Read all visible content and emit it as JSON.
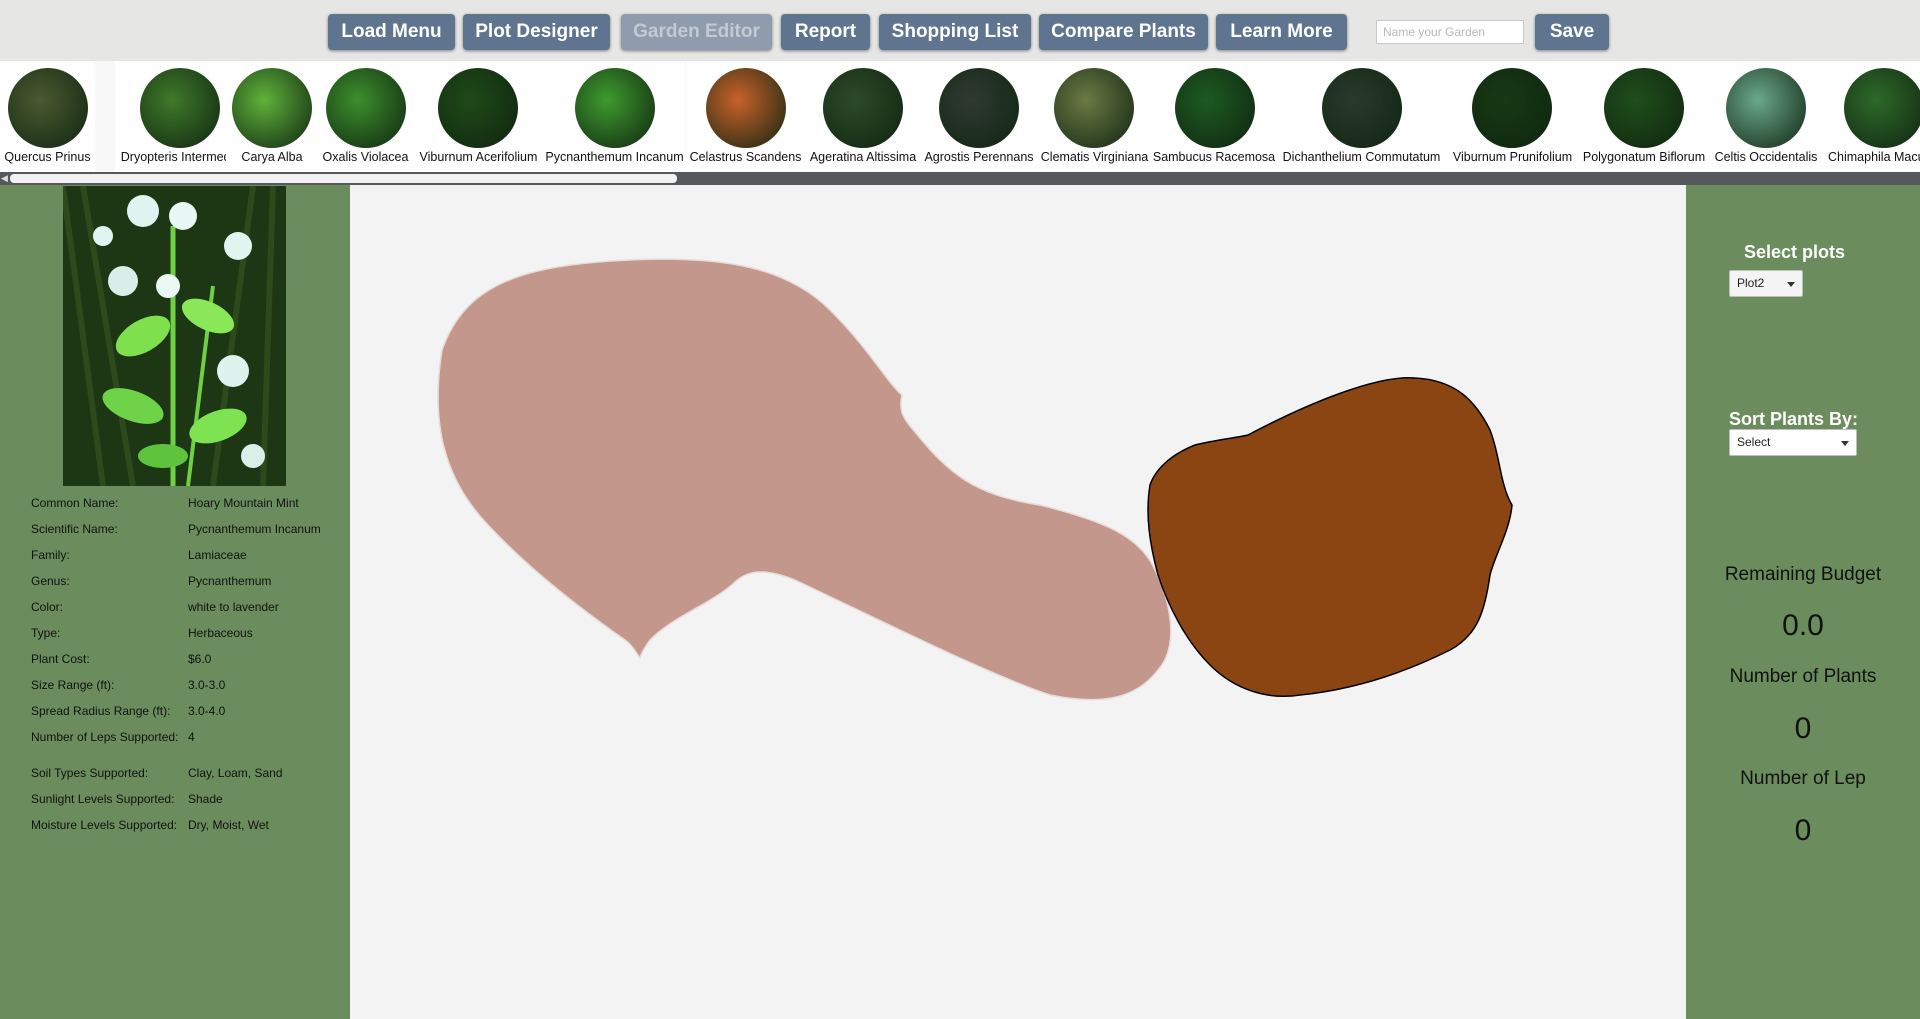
{
  "toolbar": {
    "buttons": [
      {
        "label": "Load Menu",
        "disabled": false
      },
      {
        "label": "Plot Designer",
        "disabled": false
      },
      {
        "label": "Garden Editor",
        "disabled": true
      },
      {
        "label": "Report",
        "disabled": false
      },
      {
        "label": "Shopping List",
        "disabled": false
      },
      {
        "label": "Compare Plants",
        "disabled": false
      },
      {
        "label": "Learn More",
        "disabled": false
      }
    ],
    "garden_name_placeholder": "Name your Garden",
    "garden_name_value": "",
    "save_label": "Save"
  },
  "plants": [
    {
      "name": "Quercus Prinus",
      "icon": "bark-photo",
      "color": "#4a5a30"
    },
    {
      "name": "Dryopteris Intermedia",
      "icon": "fern-photo",
      "color": "#3f7a2a"
    },
    {
      "name": "Carya Alba",
      "icon": "leaf-photo",
      "color": "#5fb23a"
    },
    {
      "name": "Oxalis Violacea",
      "icon": "violet-flower-photo",
      "color": "#3c8f2c"
    },
    {
      "name": "Viburnum Acerifolium",
      "icon": "white-flower-photo",
      "color": "#1e4a17"
    },
    {
      "name": "Pycnanthemum Incanum",
      "icon": "mint-photo",
      "color": "#3e9a2e"
    },
    {
      "name": "Celastrus Scandens",
      "icon": "berry-photo",
      "color": "#c9622a"
    },
    {
      "name": "Ageratina Altissima",
      "icon": "white-cluster-photo",
      "color": "#2c4a28"
    },
    {
      "name": "Agrostis Perennans",
      "icon": "grass-photo",
      "color": "#2f3a32"
    },
    {
      "name": "Clematis Virginiana",
      "icon": "vine-photo",
      "color": "#6b7a45"
    },
    {
      "name": "Sambucus Racemosa",
      "icon": "red-berry-photo",
      "color": "#1d5a21"
    },
    {
      "name": "Dichanthelium Commutatum",
      "icon": "grass-stem-photo",
      "color": "#2a3a2c"
    },
    {
      "name": "Viburnum Prunifolium",
      "icon": "white-flower-photo",
      "color": "#163a14"
    },
    {
      "name": "Polygonatum Biflorum",
      "icon": "leaf-photo",
      "color": "#1f4f1a"
    },
    {
      "name": "Celtis Occidentalis",
      "icon": "leaf-photo",
      "color": "#6aa88a"
    },
    {
      "name": "Chimaphila Macu",
      "icon": "leaf-photo",
      "color": "#2e6a2a"
    }
  ],
  "selected_plant": {
    "photo_icon": "mountain-mint-photo",
    "rows": [
      {
        "label": "Common Name:",
        "value": "Hoary Mountain Mint"
      },
      {
        "label": "Scientific Name:",
        "value": "Pycnanthemum Incanum"
      },
      {
        "label": "Family:",
        "value": "Lamiaceae"
      },
      {
        "label": "Genus:",
        "value": "Pycnanthemum"
      },
      {
        "label": "Color:",
        "value": "white to lavender"
      },
      {
        "label": "Type:",
        "value": "Herbaceous"
      },
      {
        "label": "Plant Cost:",
        "value": "$6.0"
      },
      {
        "label": "Size Range (ft):",
        "value": "3.0-3.0"
      },
      {
        "label": "Spread Radius Range (ft):",
        "value": "3.0-4.0"
      },
      {
        "label": "Number of Leps Supported:",
        "value": "4"
      },
      {
        "label": "Soil Types Supported:",
        "value": "Clay, Loam, Sand"
      },
      {
        "label": "Sunlight Levels Supported:",
        "value": "Shade"
      },
      {
        "label": "Moisture Levels Supported:",
        "value": "Dry, Moist, Wet"
      }
    ]
  },
  "canvas": {
    "plots": [
      {
        "icon": "plot-shape",
        "fill": "#c3978b",
        "stroke": "#e8dcd8"
      },
      {
        "icon": "plot-shape",
        "fill": "#8b4513",
        "stroke": "#000000"
      }
    ]
  },
  "right_panel": {
    "select_plots_label": "Select plots",
    "select_plots_value": "Plot2",
    "sort_label": "Sort Plants By:",
    "sort_value": "Select",
    "remaining_budget_label": "Remaining Budget",
    "remaining_budget_value": "0.0",
    "num_plants_label": "Number of Plants",
    "num_plants_value": "0",
    "num_lep_label": "Number of Lep",
    "num_lep_value": "0"
  }
}
